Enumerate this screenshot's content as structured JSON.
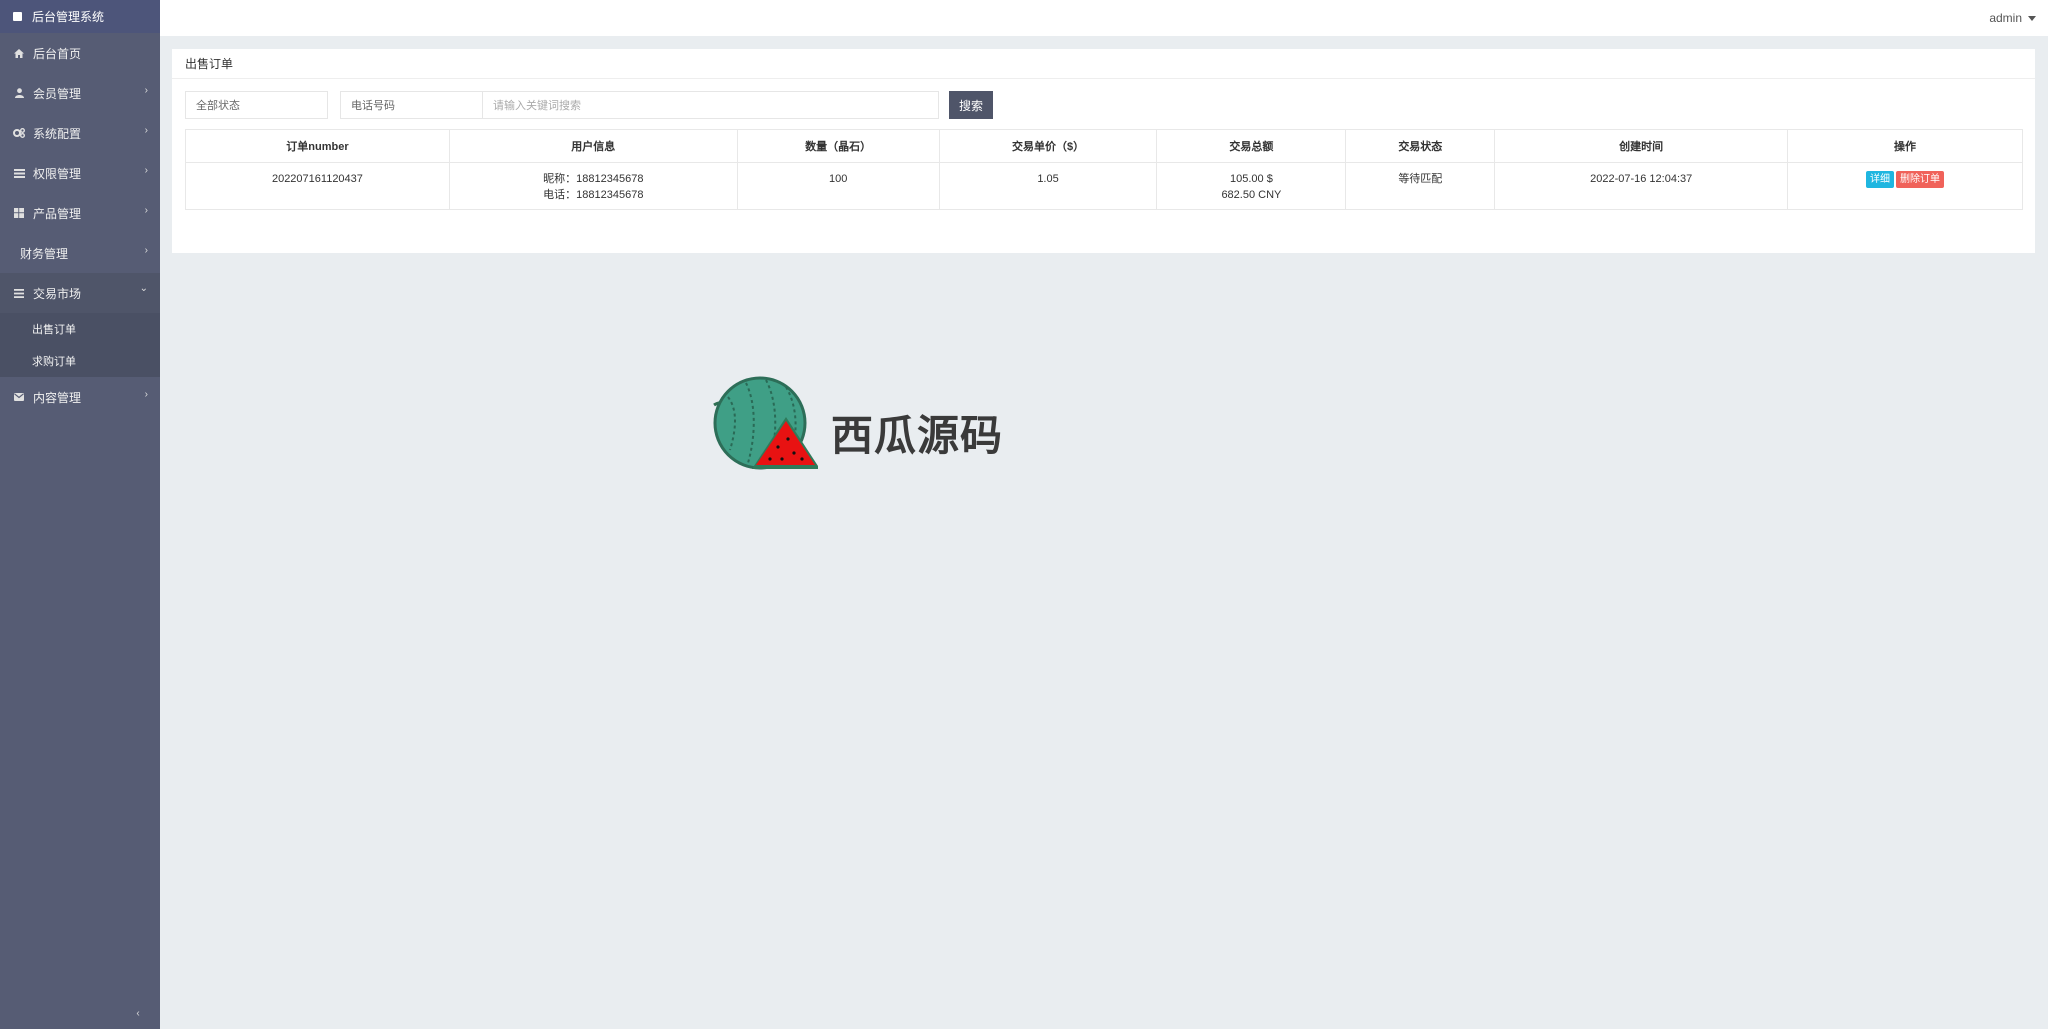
{
  "sidebar": {
    "brand": "后台管理系统",
    "items": [
      {
        "label": "后台首页",
        "icon": "home-icon"
      },
      {
        "label": "会员管理",
        "icon": "user-icon"
      },
      {
        "label": "系统配置",
        "icon": "gears-icon"
      },
      {
        "label": "权限管理",
        "icon": "table-icon"
      },
      {
        "label": "产品管理",
        "icon": "windows-icon"
      },
      {
        "label": "财务管理",
        "icon": ""
      },
      {
        "label": "交易市场",
        "icon": "list-icon"
      },
      {
        "label": "内容管理",
        "icon": "envelope-icon"
      }
    ],
    "submenu": [
      "出售订单",
      "求购订单"
    ]
  },
  "topbar": {
    "user": "admin"
  },
  "panel": {
    "title": "出售订单",
    "filters": {
      "status": "全部状态",
      "phone": "电话号码",
      "keyword_placeholder": "请输入关键词搜索",
      "search_label": "搜索"
    },
    "table": {
      "headers": [
        "订单number",
        "用户信息",
        "数量（晶石）",
        "交易单价（$）",
        "交易总额",
        "交易状态",
        "创建时间",
        "操作"
      ],
      "rows": [
        {
          "order_no": "202207161120437",
          "nickname": "昵称：18812345678",
          "phone": "电话：18812345678",
          "quantity": "100",
          "unit_price": "1.05",
          "total_usd": "105.00 $",
          "total_cny": "682.50 CNY",
          "status": "等待匹配",
          "created": "2022-07-16 12:04:37",
          "detail_label": "详细",
          "delete_label": "删除订单"
        }
      ]
    }
  },
  "watermark": {
    "text": "西瓜源码"
  },
  "colors": {
    "sidebar": "#565c74",
    "brand": "#4d557a",
    "detail_button": "#1fb6e0",
    "delete_button": "#f0625a",
    "search_button": "#4f5569"
  }
}
